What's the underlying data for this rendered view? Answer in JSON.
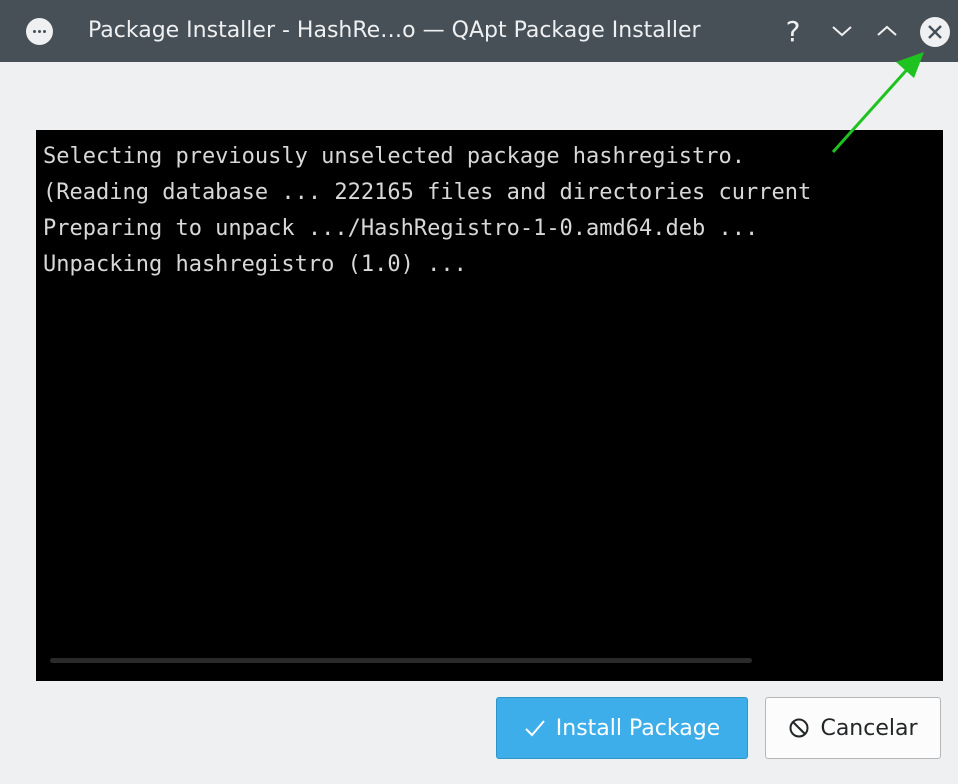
{
  "window": {
    "title": "Package Installer - HashRe…o — QApt Package Installer",
    "help_glyph": "?",
    "menu_icon": "more-dots-icon",
    "minimize_icon": "chevron-down-icon",
    "maximize_icon": "chevron-up-icon",
    "close_icon": "close-circle-icon"
  },
  "terminal": {
    "lines": [
      "Selecting previously unselected package hashregistro.",
      "(Reading database ... 222165 files and directories current",
      "Preparing to unpack .../HashRegistro-1-0.amd64.deb ...",
      "Unpacking hashregistro (1.0) ..."
    ]
  },
  "buttons": {
    "install": {
      "label": "Install Package",
      "icon": "check-icon"
    },
    "cancel": {
      "label": "Cancelar",
      "icon": "cancel-circle-icon"
    }
  },
  "colors": {
    "titlebar": "#475057",
    "accent": "#3daee9",
    "annotation_arrow": "#1fc31f"
  }
}
